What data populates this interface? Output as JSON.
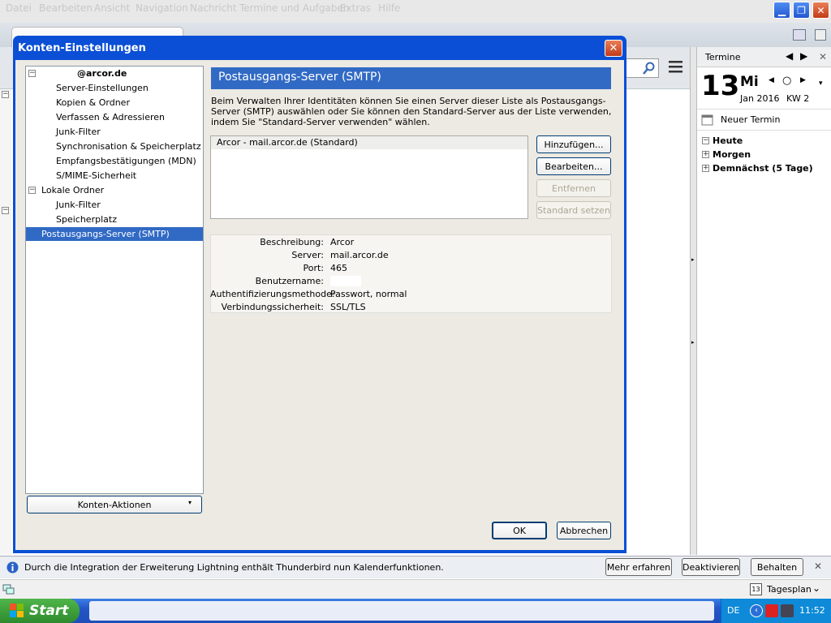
{
  "menubar": {
    "items": [
      "Datei",
      "Bearbeiten",
      "Ansicht",
      "Navigation",
      "Nachricht",
      "Termine und Aufgaben",
      "Extras",
      "Hilfe"
    ]
  },
  "calendar": {
    "title": "Termine",
    "day": "13",
    "weekday": "Mi",
    "month_year": "Jan 2016",
    "week": "KW 2",
    "new_event": "Neuer Termin",
    "sections": [
      "Heute",
      "Morgen",
      "Demnächst (5 Tage)"
    ]
  },
  "dialog": {
    "title": "Konten-Einstellungen",
    "tree": {
      "account": "@arcor.de",
      "account_children": [
        "Server-Einstellungen",
        "Kopien & Ordner",
        "Verfassen & Adressieren",
        "Junk-Filter",
        "Synchronisation & Speicherplatz",
        "Empfangsbestätigungen (MDN)",
        "S/MIME-Sicherheit"
      ],
      "local": "Lokale Ordner",
      "local_children": [
        "Junk-Filter",
        "Speicherplatz"
      ],
      "smtp": "Postausgangs-Server (SMTP)"
    },
    "account_actions": "Konten-Aktionen",
    "header": "Postausgangs-Server (SMTP)",
    "description": "Beim Verwalten Ihrer Identitäten können Sie einen Server dieser Liste als Postausgangs-Server (SMTP) auswählen oder Sie können den Standard-Server aus der Liste verwenden, indem Sie \"Standard-Server verwenden\" wählen.",
    "server_list": [
      "Arcor - mail.arcor.de (Standard)"
    ],
    "buttons": {
      "add": "Hinzufügen...",
      "edit": "Bearbeiten...",
      "remove": "Entfernen",
      "set_default": "Standard setzen",
      "ok": "OK",
      "cancel": "Abbrechen"
    },
    "details": [
      {
        "label": "Beschreibung:",
        "value": "Arcor"
      },
      {
        "label": "Server:",
        "value": "mail.arcor.de"
      },
      {
        "label": "Port:",
        "value": "465"
      },
      {
        "label": "Benutzername:",
        "value": ""
      },
      {
        "label": "Authentifizierungsmethode:",
        "value": "Passwort, normal"
      },
      {
        "label": "Verbindungssicherheit:",
        "value": "SSL/TLS"
      }
    ]
  },
  "notification": {
    "text": "Durch die Integration der Erweiterung Lightning enthält Thunderbird nun Kalenderfunktionen.",
    "more": "Mehr erfahren",
    "deactivate": "Deaktivieren",
    "keep": "Behalten"
  },
  "statusbar": {
    "today_pane": "Tagesplan",
    "today_icon_day": "13"
  },
  "taskbar": {
    "start": "Start",
    "lang": "DE",
    "clock": "11:52"
  }
}
